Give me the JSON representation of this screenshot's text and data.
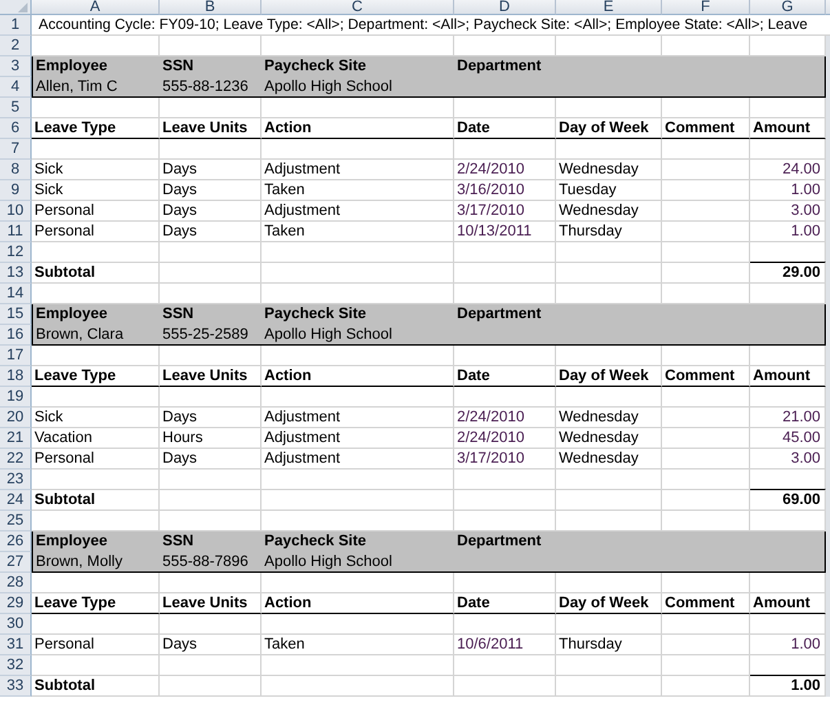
{
  "columns": [
    "A",
    "B",
    "C",
    "D",
    "E",
    "F",
    "G"
  ],
  "rows": [
    {
      "number": "1",
      "kind": "banner",
      "cells": {
        "A": "Accounting Cycle: FY09-10; Leave Type: <All>; Department: <All>; Paycheck Site: <All>; Employee State: <All>; Leave"
      }
    },
    {
      "number": "2",
      "kind": "blank"
    },
    {
      "number": "3",
      "kind": "employee-head",
      "cells": {
        "A": "Employee",
        "B": "SSN",
        "C": "Paycheck Site",
        "D": "Department"
      }
    },
    {
      "number": "4",
      "kind": "employee-info",
      "cells": {
        "A": "Allen, Tim C",
        "B": "555-88-1236",
        "C": "Apollo High School"
      }
    },
    {
      "number": "5",
      "kind": "blank"
    },
    {
      "number": "6",
      "kind": "column-head",
      "cells": {
        "A": "Leave Type",
        "B": "Leave Units",
        "C": "Action",
        "D": "Date",
        "E": "Day of Week",
        "F": "Comment",
        "G": "Amount"
      }
    },
    {
      "number": "7",
      "kind": "blank"
    },
    {
      "number": "8",
      "kind": "entry",
      "cells": {
        "A": "Sick",
        "B": "Days",
        "C": "Adjustment",
        "D": "2/24/2010",
        "E": "Wednesday",
        "G": "24.00"
      }
    },
    {
      "number": "9",
      "kind": "entry",
      "cells": {
        "A": "Sick",
        "B": "Days",
        "C": "Taken",
        "D": "3/16/2010",
        "E": "Tuesday",
        "G": "1.00"
      }
    },
    {
      "number": "10",
      "kind": "entry",
      "cells": {
        "A": "Personal",
        "B": "Days",
        "C": "Adjustment",
        "D": "3/17/2010",
        "E": "Wednesday",
        "G": "3.00"
      }
    },
    {
      "number": "11",
      "kind": "entry",
      "cells": {
        "A": "Personal",
        "B": "Days",
        "C": "Taken",
        "D": "10/13/2011",
        "E": "Thursday",
        "G": "1.00"
      }
    },
    {
      "number": "12",
      "kind": "blank"
    },
    {
      "number": "13",
      "kind": "subtotal",
      "cells": {
        "A": "Subtotal",
        "G": "29.00"
      }
    },
    {
      "number": "14",
      "kind": "blank"
    },
    {
      "number": "15",
      "kind": "employee-head",
      "cells": {
        "A": "Employee",
        "B": "SSN",
        "C": "Paycheck Site",
        "D": "Department"
      }
    },
    {
      "number": "16",
      "kind": "employee-info",
      "cells": {
        "A": "Brown, Clara",
        "B": "555-25-2589",
        "C": "Apollo High School"
      }
    },
    {
      "number": "17",
      "kind": "blank"
    },
    {
      "number": "18",
      "kind": "column-head",
      "cells": {
        "A": "Leave Type",
        "B": "Leave Units",
        "C": "Action",
        "D": "Date",
        "E": "Day of Week",
        "F": "Comment",
        "G": "Amount"
      }
    },
    {
      "number": "19",
      "kind": "blank"
    },
    {
      "number": "20",
      "kind": "entry",
      "cells": {
        "A": "Sick",
        "B": "Days",
        "C": "Adjustment",
        "D": "2/24/2010",
        "E": "Wednesday",
        "G": "21.00"
      }
    },
    {
      "number": "21",
      "kind": "entry",
      "cells": {
        "A": "Vacation",
        "B": "Hours",
        "C": "Adjustment",
        "D": "2/24/2010",
        "E": "Wednesday",
        "G": "45.00"
      }
    },
    {
      "number": "22",
      "kind": "entry",
      "cells": {
        "A": "Personal",
        "B": "Days",
        "C": "Adjustment",
        "D": "3/17/2010",
        "E": "Wednesday",
        "G": "3.00"
      }
    },
    {
      "number": "23",
      "kind": "blank"
    },
    {
      "number": "24",
      "kind": "subtotal",
      "cells": {
        "A": "Subtotal",
        "G": "69.00"
      }
    },
    {
      "number": "25",
      "kind": "blank"
    },
    {
      "number": "26",
      "kind": "employee-head",
      "cells": {
        "A": "Employee",
        "B": "SSN",
        "C": "Paycheck Site",
        "D": "Department"
      }
    },
    {
      "number": "27",
      "kind": "employee-info",
      "cells": {
        "A": "Brown, Molly",
        "B": "555-88-7896",
        "C": "Apollo High School"
      }
    },
    {
      "number": "28",
      "kind": "blank"
    },
    {
      "number": "29",
      "kind": "column-head",
      "cells": {
        "A": "Leave Type",
        "B": "Leave Units",
        "C": "Action",
        "D": "Date",
        "E": "Day of Week",
        "F": "Comment",
        "G": "Amount"
      }
    },
    {
      "number": "30",
      "kind": "blank"
    },
    {
      "number": "31",
      "kind": "entry",
      "cells": {
        "A": "Personal",
        "B": "Days",
        "C": "Taken",
        "D": "10/6/2011",
        "E": "Thursday",
        "G": "1.00"
      }
    },
    {
      "number": "32",
      "kind": "blank"
    },
    {
      "number": "33",
      "kind": "subtotal",
      "cells": {
        "A": "Subtotal",
        "G": "1.00"
      }
    }
  ]
}
